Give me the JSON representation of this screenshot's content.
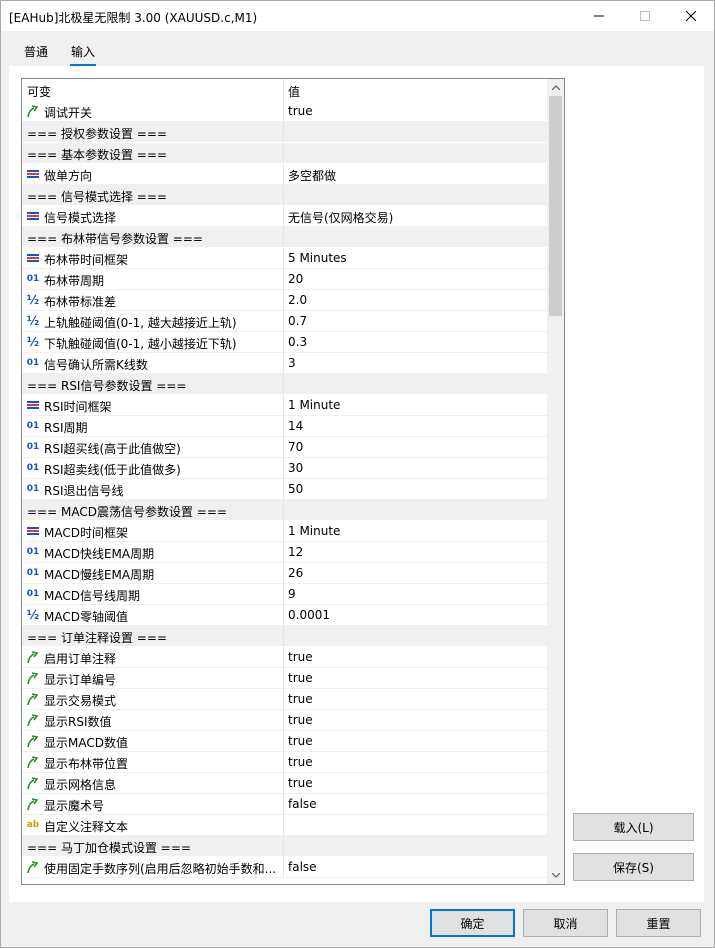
{
  "window": {
    "title": "[EAHub]北极星无限制 3.00 (XAUUSD.c,M1)"
  },
  "tabs": [
    {
      "label": "普通"
    },
    {
      "label": "输入"
    }
  ],
  "grid": {
    "headers": {
      "name": "可变",
      "value": "值"
    },
    "rows": [
      {
        "icon": "bool",
        "name": "调试开关",
        "value": "true"
      },
      {
        "icon": "section",
        "name": "=== 授权参数设置 ===",
        "value": ""
      },
      {
        "icon": "section",
        "name": "=== 基本参数设置 ===",
        "value": ""
      },
      {
        "icon": "enum",
        "name": "做单方向",
        "value": "多空都做"
      },
      {
        "icon": "section",
        "name": "=== 信号模式选择 ===",
        "value": ""
      },
      {
        "icon": "enum",
        "name": "信号模式选择",
        "value": "无信号(仅网格交易)"
      },
      {
        "icon": "section",
        "name": "=== 布林带信号参数设置 ===",
        "value": ""
      },
      {
        "icon": "enum",
        "name": "布林带时间框架",
        "value": "5 Minutes"
      },
      {
        "icon": "int",
        "name": "布林带周期",
        "value": "20"
      },
      {
        "icon": "double",
        "name": "布林带标准差",
        "value": "2.0"
      },
      {
        "icon": "double",
        "name": "上轨触碰阈值(0-1, 越大越接近上轨)",
        "value": "0.7"
      },
      {
        "icon": "double",
        "name": "下轨触碰阈值(0-1, 越小越接近下轨)",
        "value": "0.3"
      },
      {
        "icon": "int",
        "name": "信号确认所需K线数",
        "value": "3"
      },
      {
        "icon": "section",
        "name": "=== RSI信号参数设置 ===",
        "value": ""
      },
      {
        "icon": "enum",
        "name": "RSI时间框架",
        "value": "1 Minute"
      },
      {
        "icon": "int",
        "name": "RSI周期",
        "value": "14"
      },
      {
        "icon": "int",
        "name": "RSI超买线(高于此值做空)",
        "value": "70"
      },
      {
        "icon": "int",
        "name": "RSI超卖线(低于此值做多)",
        "value": "30"
      },
      {
        "icon": "int",
        "name": "RSI退出信号线",
        "value": "50"
      },
      {
        "icon": "section",
        "name": "=== MACD震荡信号参数设置 ===",
        "value": ""
      },
      {
        "icon": "enum",
        "name": "MACD时间框架",
        "value": "1 Minute"
      },
      {
        "icon": "int",
        "name": "MACD快线EMA周期",
        "value": "12"
      },
      {
        "icon": "int",
        "name": "MACD慢线EMA周期",
        "value": "26"
      },
      {
        "icon": "int",
        "name": "MACD信号线周期",
        "value": "9"
      },
      {
        "icon": "double",
        "name": "MACD零轴阈值",
        "value": "0.0001"
      },
      {
        "icon": "section",
        "name": "=== 订单注释设置 ===",
        "value": ""
      },
      {
        "icon": "bool",
        "name": "启用订单注释",
        "value": "true"
      },
      {
        "icon": "bool",
        "name": "显示订单编号",
        "value": "true"
      },
      {
        "icon": "bool",
        "name": "显示交易模式",
        "value": "true"
      },
      {
        "icon": "bool",
        "name": "显示RSI数值",
        "value": "true"
      },
      {
        "icon": "bool",
        "name": "显示MACD数值",
        "value": "true"
      },
      {
        "icon": "bool",
        "name": "显示布林带位置",
        "value": "true"
      },
      {
        "icon": "bool",
        "name": "显示网格信息",
        "value": "true"
      },
      {
        "icon": "bool",
        "name": "显示魔术号",
        "value": "false"
      },
      {
        "icon": "string",
        "name": "自定义注释文本",
        "value": ""
      },
      {
        "icon": "section",
        "name": "=== 马丁加仓模式设置 ===",
        "value": ""
      },
      {
        "icon": "bool",
        "name": "使用固定手数序列(启用后忽略初始手数和...",
        "value": "false"
      }
    ]
  },
  "buttons": {
    "load": "载入(L)",
    "save": "保存(S)",
    "ok": "确定",
    "cancel": "取消",
    "reset": "重置"
  },
  "icon_glyphs": {
    "int": "01",
    "double": "½",
    "string": "ab"
  },
  "colors": {
    "accent": "#0078d7",
    "bool_icon": "#2e8b2e",
    "enum_icon": "#1e50c8",
    "enum_icon_red": "#d23c3c"
  }
}
